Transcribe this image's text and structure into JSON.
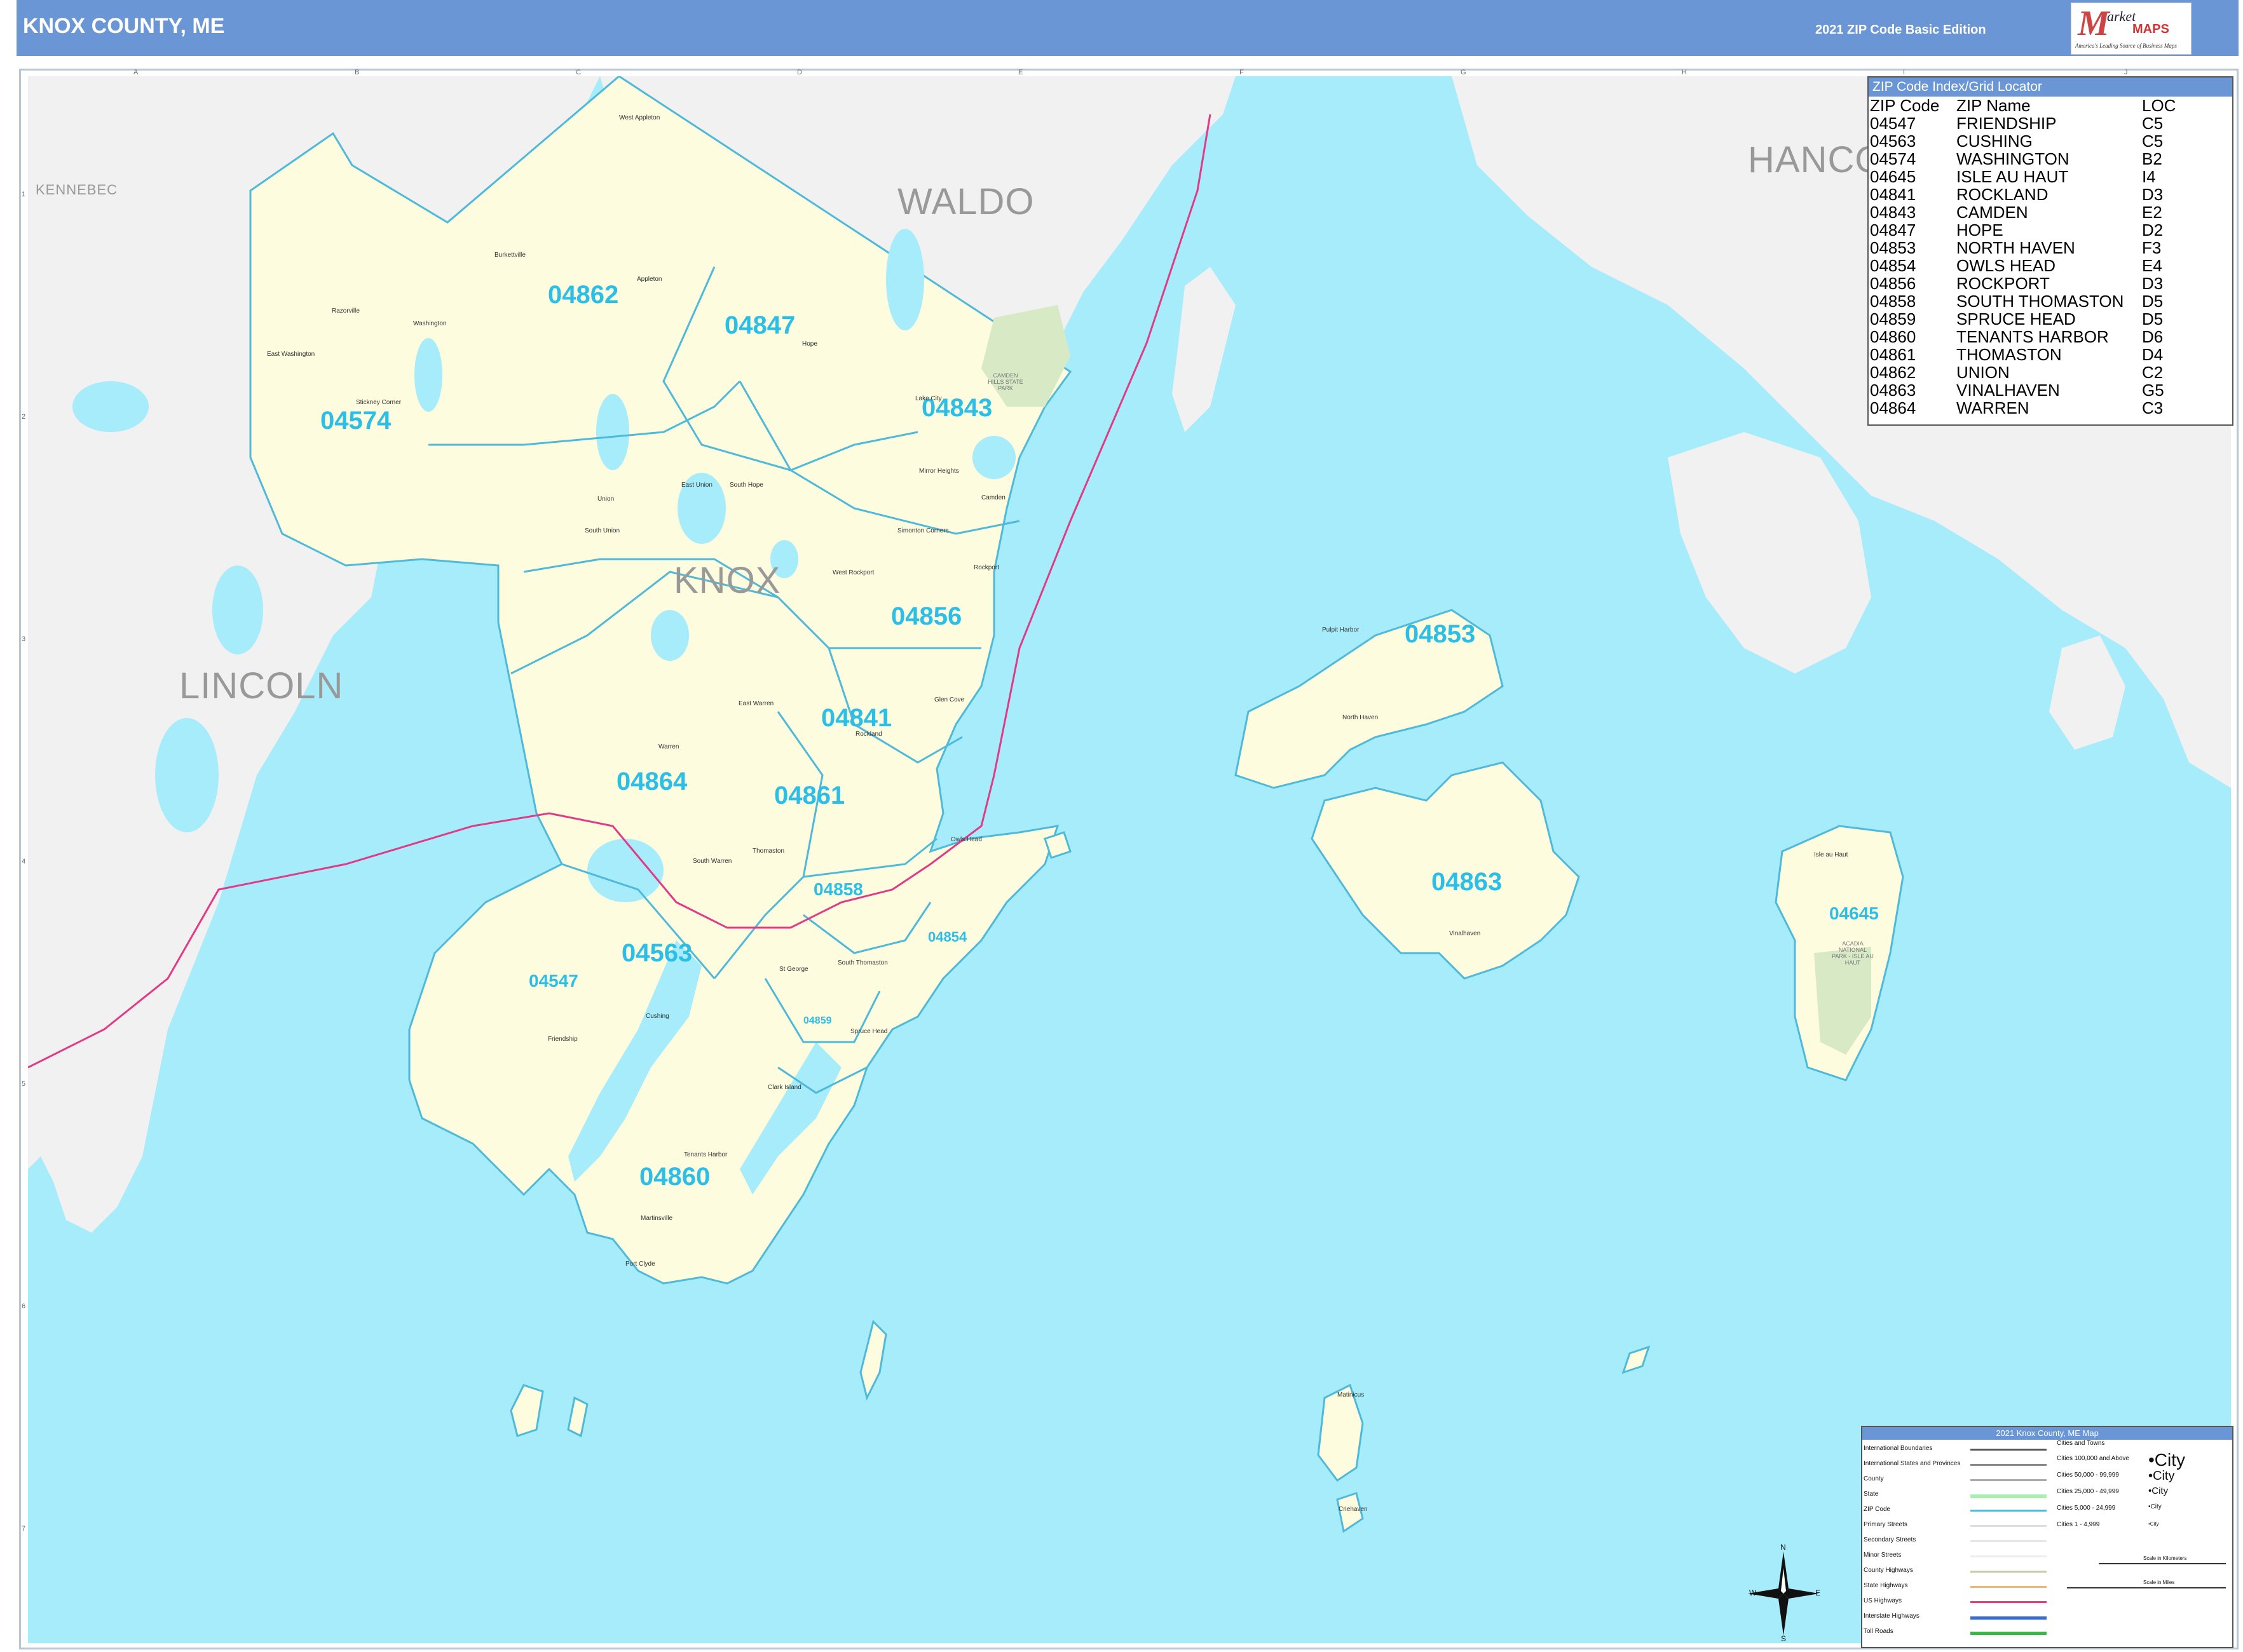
{
  "header": {
    "title": "KNOX COUNTY, ME",
    "edition": "2021 ZIP Code Basic Edition",
    "logo_m": "M",
    "logo_market": "arket",
    "logo_maps": "MAPS",
    "logo_tagline": "America's Leading Source of Business Maps"
  },
  "grid": {
    "columns": [
      "A",
      "B",
      "C",
      "D",
      "E",
      "F",
      "G",
      "H",
      "I",
      "J"
    ],
    "rows": [
      "1",
      "2",
      "3",
      "4",
      "5",
      "6",
      "7"
    ]
  },
  "regions": {
    "knox": "KNOX",
    "waldo": "WALDO",
    "lincoln": "LINCOLN",
    "kennebec": "KENNEBEC",
    "hancock": "HANCO"
  },
  "zips": {
    "z04862": "04862",
    "z04847": "04847",
    "z04574": "04574",
    "z04843": "04843",
    "z04856": "04856",
    "z04841": "04841",
    "z04864": "04864",
    "z04861": "04861",
    "z04858": "04858",
    "z04854": "04854",
    "z04563": "04563",
    "z04547": "04547",
    "z04859": "04859",
    "z04860": "04860",
    "z04853": "04853",
    "z04863": "04863",
    "z04645": "04645"
  },
  "index": {
    "title": "ZIP Code Index/Grid Locator",
    "headers": [
      "ZIP Code",
      "ZIP Name",
      "LOC"
    ],
    "rows": [
      [
        "04547",
        "FRIENDSHIP",
        "C5"
      ],
      [
        "04563",
        "CUSHING",
        "C5"
      ],
      [
        "04574",
        "WASHINGTON",
        "B2"
      ],
      [
        "04645",
        "ISLE AU HAUT",
        "I4"
      ],
      [
        "04841",
        "ROCKLAND",
        "D3"
      ],
      [
        "04843",
        "CAMDEN",
        "E2"
      ],
      [
        "04847",
        "HOPE",
        "D2"
      ],
      [
        "04853",
        "NORTH HAVEN",
        "F3"
      ],
      [
        "04854",
        "OWLS HEAD",
        "E4"
      ],
      [
        "04856",
        "ROCKPORT",
        "D3"
      ],
      [
        "04858",
        "SOUTH THOMASTON",
        "D5"
      ],
      [
        "04859",
        "SPRUCE HEAD",
        "D5"
      ],
      [
        "04860",
        "TENANTS HARBOR",
        "D6"
      ],
      [
        "04861",
        "THOMASTON",
        "D4"
      ],
      [
        "04862",
        "UNION",
        "C2"
      ],
      [
        "04863",
        "VINALHAVEN",
        "G5"
      ],
      [
        "04864",
        "WARREN",
        "C3"
      ]
    ]
  },
  "legend": {
    "title": "2021 Knox County, ME Map",
    "left_items": [
      "International Boundaries",
      "International States and Provinces",
      "County",
      "State",
      "ZIP Code",
      "Primary Streets",
      "Secondary Streets",
      "Minor Streets",
      "County Highways",
      "State Highways",
      "US Highways",
      "Interstate Highways",
      "Toll Roads"
    ],
    "cities_header": "Cities and Towns",
    "city_items": [
      {
        "range": "Cities 100,000 and Above",
        "sample": "•City"
      },
      {
        "range": "Cities 50,000 - 99,999",
        "sample": "•City"
      },
      {
        "range": "Cities 25,000 - 49,999",
        "sample": "•City"
      },
      {
        "range": "Cities 5,000 - 24,999",
        "sample": "•City"
      },
      {
        "range": "Cities 1 - 4,999",
        "sample": "•City"
      }
    ],
    "scale_km": "Scale in Kilometers",
    "scale_mi": "Scale in Miles",
    "compass": {
      "n": "N",
      "s": "S",
      "e": "E",
      "w": "W"
    }
  },
  "towns": {
    "west_appleton": "West Appleton",
    "burkettville": "Burkettville",
    "appleton": "Appleton",
    "razorville": "Razorville",
    "washington": "Washington",
    "east_washington": "East Washington",
    "stickney_corner": "Stickney Corner",
    "hope": "Hope",
    "lake_city": "Lake City",
    "union": "Union",
    "east_union": "East Union",
    "south_hope": "South Hope",
    "south_union": "South Union",
    "mirror_heights": "Mirror Heights",
    "camden": "Camden",
    "simonton": "Simonton Corners",
    "west_rockport": "West Rockport",
    "rockport": "Rockport",
    "glen_cove": "Glen Cove",
    "east_warren": "East Warren",
    "rockland": "Rockland",
    "warren": "Warren",
    "thomaston": "Thomaston",
    "south_warren": "South Warren",
    "owls_head": "Owls Head",
    "south_thomaston": "South Thomaston",
    "cushing": "Cushing",
    "friendship": "Friendship",
    "st_george": "St George",
    "spruce_head": "Spruce Head",
    "clark_island": "Clark Island",
    "tenants_harbor": "Tenants Harbor",
    "martinsville": "Martinsville",
    "port_clyde": "Port Clyde",
    "pulpit_harbor": "Pulpit Harbor",
    "north_haven": "North Haven",
    "vinalhaven": "Vinalhaven",
    "isle_au_haut": "Isle au Haut",
    "matinicus": "Matinicus",
    "criehaven": "Criehaven",
    "acadia": "ACADIA NATIONAL PARK - ISLE AU HAUT",
    "camden_hills": "CAMDEN HILLS STATE PARK"
  },
  "colors": {
    "water": "#a6ecfb",
    "land": "#f1f1f1",
    "county": "#fdfcde",
    "zip_line": "#4fb9d9",
    "zip_label": "#2bbfe7",
    "header": "#6a96d6",
    "road": "#e13a86"
  }
}
